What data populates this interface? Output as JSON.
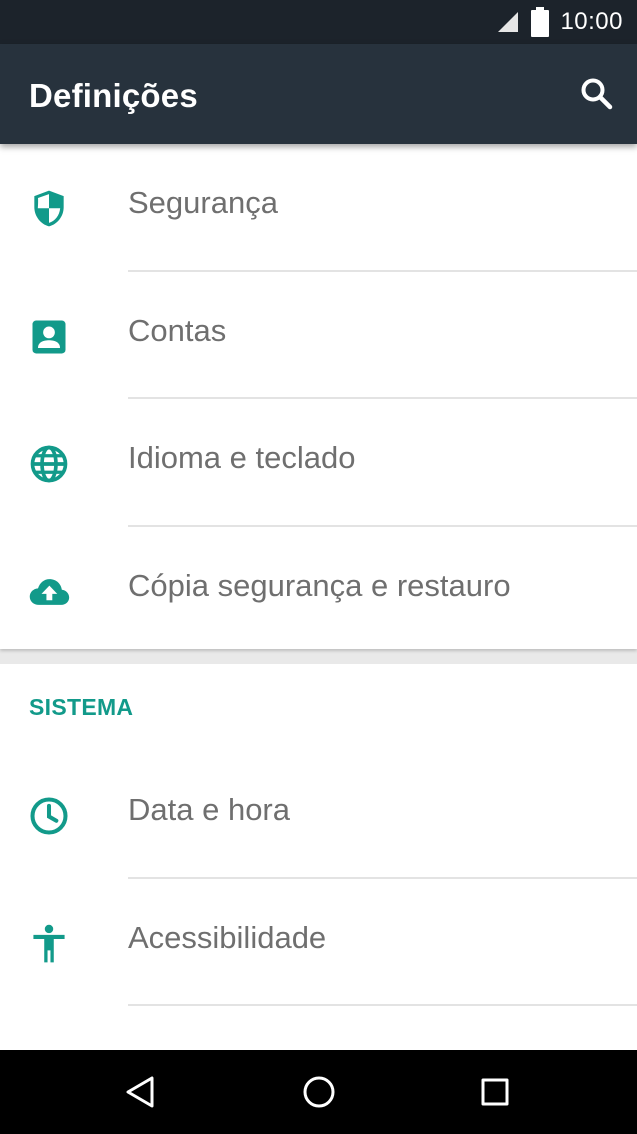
{
  "status_bar": {
    "time": "10:00",
    "icons": [
      "signal-icon",
      "battery-icon"
    ]
  },
  "app_bar": {
    "title": "Definições",
    "actions": [
      "search-icon"
    ]
  },
  "colors": {
    "accent": "#129A8A",
    "app_bar": "#27323D",
    "status_bar": "#1C232B",
    "label_text": "#6F6F6F"
  },
  "personal": {
    "items": [
      {
        "label": "Segurança",
        "icon": "shield-icon"
      },
      {
        "label": "Contas",
        "icon": "account-box-icon"
      },
      {
        "label": "Idioma e teclado",
        "icon": "globe-icon"
      },
      {
        "label": "Cópia segurança e restauro",
        "icon": "cloud-upload-icon"
      }
    ]
  },
  "system": {
    "header": "SISTEMA",
    "items": [
      {
        "label": "Data e hora",
        "icon": "clock-icon"
      },
      {
        "label": "Acessibilidade",
        "icon": "accessibility-icon"
      }
    ]
  },
  "nav_bar": {
    "buttons": [
      "back-icon",
      "home-icon",
      "recents-icon"
    ]
  }
}
